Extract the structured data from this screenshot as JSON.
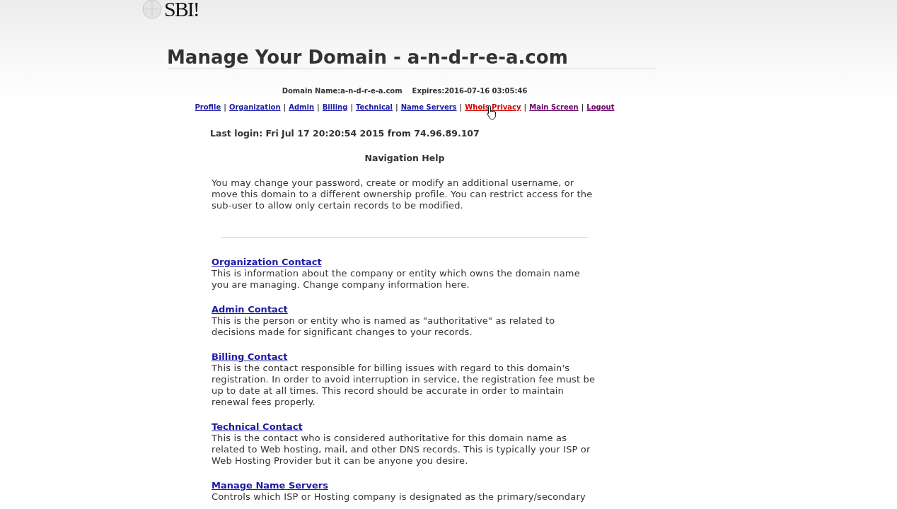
{
  "logo": {
    "text": "SBI!"
  },
  "title": "Manage Your Domain - a-n-d-r-e-a.com",
  "domain_info": [
    "Domain Name:a-n-d-r-e-a.com",
    "Expires:2016-07-16 03:05:46"
  ],
  "nav_links": [
    {
      "label": "Profile",
      "hovered": false,
      "visited": false
    },
    {
      "separator": "|",
      "label": "Organization",
      "hovered": false,
      "visited": false
    },
    {
      "separator": "|",
      "label": "Admin",
      "hovered": false,
      "visited": false
    },
    {
      "separator": "|",
      "label": "Billing",
      "hovered": false,
      "visited": false
    },
    {
      "separator": "|",
      "label": "Technical",
      "hovered": false,
      "visited": false
    },
    {
      "separator": "|",
      "label": "Name Servers",
      "hovered": false,
      "visited": false
    },
    {
      "separator": "|",
      "label": "Whois Privacy",
      "hovered": true,
      "visited": false
    },
    {
      "separator": "|",
      "label": "Main Screen",
      "hovered": false,
      "visited": true
    },
    {
      "separator": "|",
      "label": "Logout",
      "hovered": false,
      "visited": true
    }
  ],
  "last_login": "Last login: Fri Jul 17 20:20:54 2015 from 74.96.89.107",
  "help_heading": "Navigation Help",
  "help_text": "You may change your password, create or modify an additional username, or move this domain to a different ownership profile. You can restrict access for the sub-user to allow only certain records to be modified.",
  "sections": [
    {
      "link": "Organization Contact",
      "text": "This is information about the company or entity which owns the domain name you are managing. Change company information here."
    },
    {
      "link": "Admin Contact",
      "text": "This is the person or entity who is named as \"authoritative\" as related to decisions made for significant changes to your records."
    },
    {
      "link": "Billing Contact",
      "text": "This is the contact responsible for billing issues with regard to this domain's registration. In order to avoid interruption in service, the registration fee must be up to date at all times. This record should be accurate in order to maintain renewal fees properly."
    },
    {
      "link": "Technical Contact",
      "text": "This is the contact who is considered authoritative for this domain name as related to Web hosting, mail, and other DNS records. This is typically your ISP or Web Hosting Provider but it can be anyone you desire."
    },
    {
      "link": "Manage Name Servers",
      "text": "Controls which ISP or Hosting company is designated as the primary/secondary"
    }
  ]
}
